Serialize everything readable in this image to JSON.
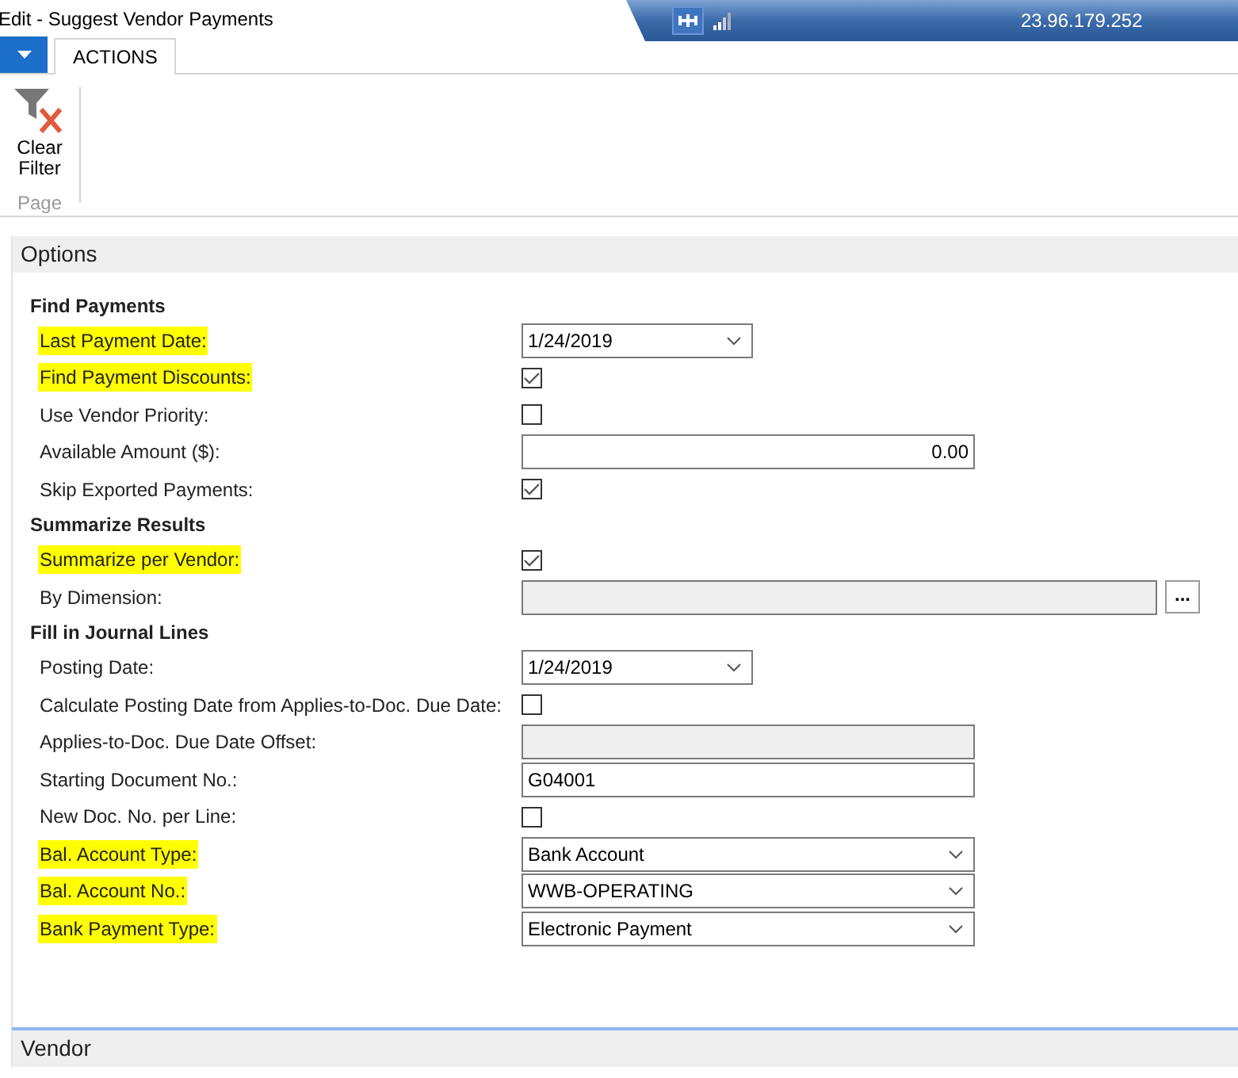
{
  "window": {
    "title": "Edit - Suggest Vendor Payments"
  },
  "remote_bar": {
    "address": "23.96.179.252"
  },
  "ribbon": {
    "tabs": [
      {
        "label": "ACTIONS",
        "selected": true
      }
    ],
    "groups": [
      {
        "label": "Page",
        "actions": [
          {
            "label": "Clear Filter"
          }
        ]
      }
    ]
  },
  "sections": [
    {
      "title": "Options",
      "expanded": true,
      "groups": [
        {
          "heading": "Find Payments",
          "fields": [
            {
              "label": "Last Payment Date:",
              "kind": "date",
              "value": "1/24/2019",
              "highlighted": true
            },
            {
              "label": "Find Payment Discounts:",
              "kind": "checkbox",
              "checked": true,
              "highlighted": true
            },
            {
              "label": "Use Vendor Priority:",
              "kind": "checkbox",
              "checked": false,
              "highlighted": false
            },
            {
              "label": "Available Amount ($):",
              "kind": "number",
              "value": "0.00",
              "highlighted": false
            },
            {
              "label": "Skip Exported Payments:",
              "kind": "checkbox",
              "checked": true,
              "highlighted": false
            }
          ]
        },
        {
          "heading": "Summarize Results",
          "fields": [
            {
              "label": "Summarize per Vendor:",
              "kind": "checkbox",
              "checked": true,
              "highlighted": true
            },
            {
              "label": "By Dimension:",
              "kind": "lookup",
              "button": "...",
              "highlighted": false
            }
          ]
        },
        {
          "heading": "Fill in Journal Lines",
          "fields": [
            {
              "label": "Posting Date:",
              "kind": "date",
              "value": "1/24/2019",
              "highlighted": false
            },
            {
              "label": "Calculate Posting Date from Applies-to-Doc. Due Date:",
              "kind": "checkbox",
              "checked": false,
              "highlighted": false
            },
            {
              "label": "Applies-to-Doc. Due Date Offset:",
              "kind": "disabled",
              "highlighted": false
            },
            {
              "label": "Starting Document No.:",
              "kind": "text",
              "value": "G04001",
              "highlighted": false
            },
            {
              "label": "New Doc. No. per Line:",
              "kind": "checkbox",
              "checked": false,
              "highlighted": false
            },
            {
              "label": "Bal. Account Type:",
              "kind": "select",
              "value": "Bank Account",
              "highlighted": true
            },
            {
              "label": "Bal. Account No.:",
              "kind": "select",
              "value": "WWB-OPERATING",
              "highlighted": true
            },
            {
              "label": "Bank Payment Type:",
              "kind": "select",
              "value": "Electronic Payment",
              "highlighted": true
            }
          ]
        }
      ]
    },
    {
      "title": "Vendor",
      "expanded": false
    }
  ]
}
